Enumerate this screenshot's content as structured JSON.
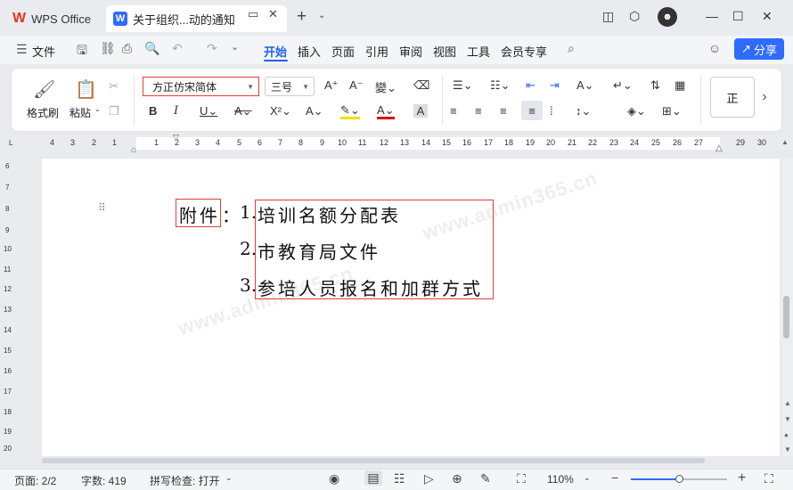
{
  "titlebar": {
    "home_tab": "WPS Office",
    "doc_tab": "关于组织...动的通知",
    "new_tab": "+"
  },
  "menubar": {
    "file": "文件",
    "tabs": [
      "开始",
      "插入",
      "页面",
      "引用",
      "审阅",
      "视图",
      "工具",
      "会员专享"
    ],
    "active_tab": "开始",
    "share": "分享"
  },
  "ribbon": {
    "format_painter": "格式刷",
    "paste": "粘贴",
    "font_name": "方正仿宋简体",
    "font_size": "三号",
    "style_preview": "正"
  },
  "ruler": {
    "left_numbers": [
      "4",
      "3",
      "2",
      "1"
    ],
    "numbers": [
      "1",
      "2",
      "3",
      "4",
      "5",
      "6",
      "7",
      "8",
      "9",
      "10",
      "11",
      "12",
      "13",
      "14",
      "15",
      "16",
      "17",
      "18",
      "19",
      "20",
      "21",
      "22",
      "23",
      "24",
      "25",
      "26",
      "27"
    ],
    "right_numbers": [
      "29",
      "30"
    ],
    "vertical_numbers": [
      "6",
      "7",
      "8",
      "9",
      "10",
      "11",
      "12",
      "13",
      "14",
      "15",
      "16",
      "17",
      "18",
      "19",
      "20"
    ]
  },
  "document": {
    "attachment_label": "附件",
    "colon": "：",
    "items": [
      {
        "num": "1.",
        "text": "培训名额分配表"
      },
      {
        "num": "2.",
        "text": "市教育局文件"
      },
      {
        "num": "3.",
        "text": "参培人员报名和加群方式"
      }
    ],
    "watermark": "www.admin365.cn"
  },
  "statusbar": {
    "page": "页面: 2/2",
    "words": "字数: 419",
    "spell": "拼写检查: 打开",
    "zoom": "110%",
    "zoom_minus": "−",
    "zoom_plus": "+"
  },
  "colors": {
    "accent": "#2f6bff",
    "highlight_box": "#e23c3c",
    "wps_red": "#e8321e"
  }
}
